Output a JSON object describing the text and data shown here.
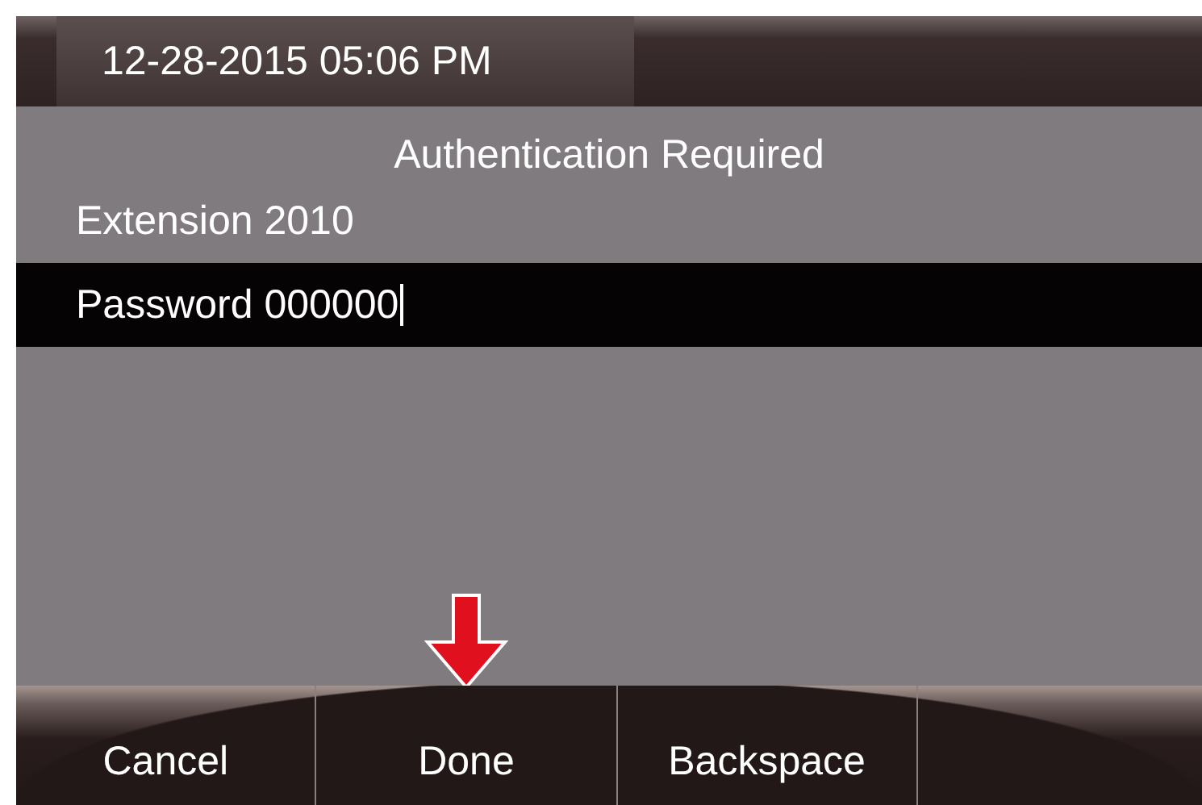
{
  "status_bar": {
    "datetime": "12-28-2015 05:06 PM"
  },
  "dialog": {
    "title": "Authentication Required",
    "extension": {
      "text": "Extension 2010"
    },
    "password": {
      "text": "Password 000000",
      "focused": true
    }
  },
  "softkeys": [
    {
      "label": "Cancel",
      "pointed_at": false
    },
    {
      "label": "Done",
      "pointed_at": true
    },
    {
      "label": "Backspace",
      "pointed_at": false
    }
  ]
}
